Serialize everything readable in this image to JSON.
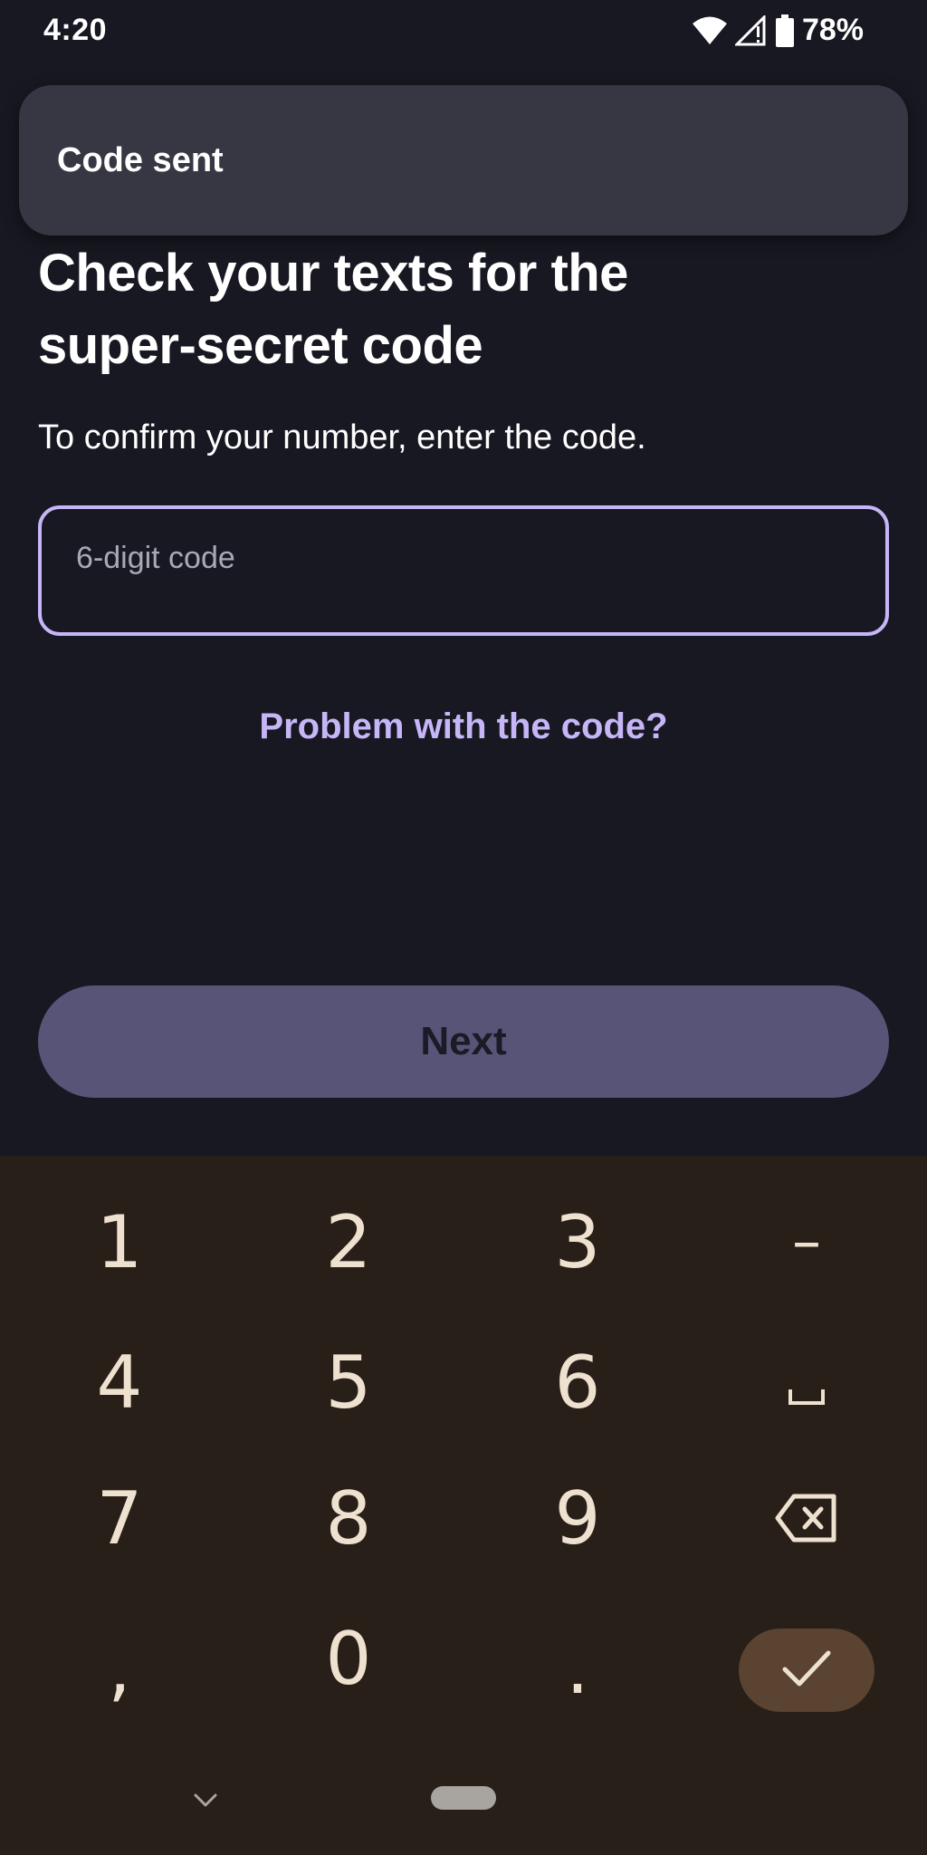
{
  "status_bar": {
    "time": "4:20",
    "battery": "78%",
    "icons": [
      "wifi-icon",
      "cell-signal-icon",
      "battery-icon"
    ]
  },
  "toast": {
    "text": "Code sent"
  },
  "main": {
    "heading_line1": "Check your texts for the",
    "heading_line2": "super-secret code",
    "subtext": "To confirm your number, enter the code.",
    "code_placeholder": "6-digit code",
    "code_value": "",
    "problem_link": "Problem with the code?",
    "next_label": "Next"
  },
  "keyboard": {
    "keys": {
      "k1": "1",
      "k2": "2",
      "k3": "3",
      "dash": "–",
      "k4": "4",
      "k5": "5",
      "k6": "6",
      "k7": "7",
      "k8": "8",
      "k9": "9",
      "comma": ",",
      "k0": "0",
      "period": "."
    },
    "icons": [
      "space-icon",
      "backspace-icon",
      "checkmark-icon",
      "chevron-down-icon"
    ]
  },
  "colors": {
    "background": "#181822",
    "accent": "#c6b6f7",
    "button_disabled": "#575477",
    "toast": "#373744",
    "keyboard_bg": "#281f19",
    "keyboard_key_text": "#efe1cf",
    "enter_key": "#5a4330"
  }
}
